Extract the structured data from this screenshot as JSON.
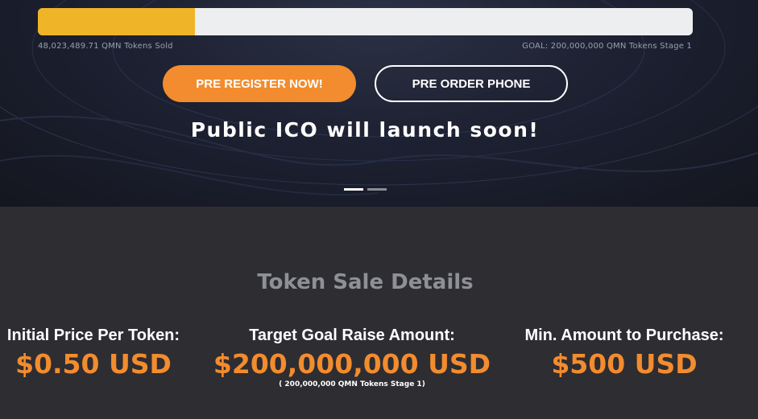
{
  "progress": {
    "fraction_sold": 0.24,
    "sold_label": "48,023,489.71 QMN Tokens Sold",
    "goal_label": "GOAL: 200,000,000 QMN Tokens Stage 1",
    "fill_color": "#f0b429",
    "track_color": "#eceef0"
  },
  "buttons": {
    "pre_register": "PRE REGISTER NOW!",
    "pre_order": "PRE ORDER PHONE"
  },
  "hero": {
    "headline": "Public ICO will launch soon!",
    "slides": {
      "count": 2,
      "active": 1
    }
  },
  "token_sale": {
    "title": "Token Sale Details",
    "items": [
      {
        "label": "Initial Price Per Token:",
        "value": "$0.50 USD"
      },
      {
        "label": "Target Goal Raise Amount:",
        "value": "$200,000,000 USD",
        "note": "( 200,000,000 QMN Tokens Stage 1)"
      },
      {
        "label": "Min. Amount to Purchase:",
        "value": "$500 USD"
      }
    ]
  },
  "colors": {
    "accent": "#f28c2e",
    "background": "#2e2d32",
    "hero_background": "#1d2132"
  }
}
